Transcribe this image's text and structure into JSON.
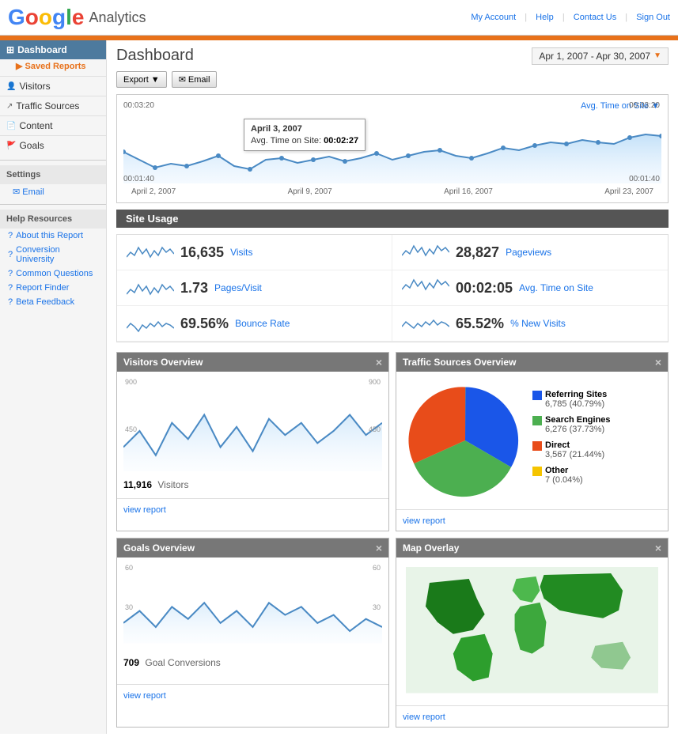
{
  "header": {
    "logo_google": "Google",
    "logo_analytics": "Analytics",
    "nav": {
      "my_account": "My Account",
      "help": "Help",
      "contact_us": "Contact Us",
      "sign_out": "Sign Out"
    }
  },
  "sidebar": {
    "dashboard_label": "Dashboard",
    "saved_reports_label": "Saved Reports",
    "nav_items": [
      {
        "label": "Visitors",
        "icon": "👤"
      },
      {
        "label": "Traffic Sources",
        "icon": "🔗"
      },
      {
        "label": "Content",
        "icon": "📄"
      },
      {
        "label": "Goals",
        "icon": "🎯"
      }
    ],
    "settings": {
      "label": "Settings",
      "items": [
        "Email"
      ]
    },
    "help": {
      "label": "Help Resources",
      "items": [
        "About this Report",
        "Conversion University",
        "Common Questions",
        "Report Finder",
        "Beta Feedback"
      ]
    }
  },
  "main": {
    "page_title": "Dashboard",
    "date_range": "Apr 1, 2007 - Apr 30, 2007",
    "toolbar": {
      "export_label": "Export",
      "email_label": "Email"
    },
    "chart": {
      "label": "Avg. Time on Site ▼",
      "y_top": "00:03:20",
      "y_bottom": "00:01:40",
      "y_top_right": "00:03:20",
      "y_bottom_right": "00:01:40",
      "x_labels": [
        "April 2, 2007",
        "April 9, 2007",
        "April 16, 2007",
        "April 23, 2007"
      ],
      "tooltip": {
        "date": "April 3, 2007",
        "metric_label": "Avg. Time on Site: ",
        "metric_value": "00:02:27"
      }
    },
    "site_usage_label": "Site Usage",
    "metrics": [
      {
        "value": "16,635",
        "label": "Visits"
      },
      {
        "value": "28,827",
        "label": "Pageviews"
      },
      {
        "value": "1.73",
        "label": "Pages/Visit"
      },
      {
        "value": "00:02:05",
        "label": "Avg. Time on Site"
      },
      {
        "value": "69.56%",
        "label": "Bounce Rate"
      },
      {
        "value": "65.52%",
        "label": "% New Visits"
      }
    ],
    "visitors_panel": {
      "title": "Visitors Overview",
      "visitors_count": "11,916",
      "visitors_label": "Visitors",
      "y_top": "900",
      "y_top_right": "900",
      "y_mid": "450",
      "y_mid_right": "450",
      "view_report": "view report"
    },
    "traffic_panel": {
      "title": "Traffic Sources Overview",
      "view_report": "view report",
      "legend": [
        {
          "color": "#1a56e8",
          "name": "Referring Sites",
          "detail": "6,785 (40.79%)"
        },
        {
          "color": "#4caf50",
          "name": "Search Engines",
          "detail": "6,276 (37.73%)"
        },
        {
          "color": "#e84c1a",
          "name": "Direct",
          "detail": "3,567 (21.44%)"
        },
        {
          "color": "#f5c400",
          "name": "Other",
          "detail": "7 (0.04%)"
        }
      ]
    },
    "goals_panel": {
      "title": "Goals Overview",
      "conversions": "709",
      "conversions_label": "Goal Conversions",
      "y_top": "60",
      "y_top_right": "60",
      "y_mid": "30",
      "y_mid_right": "30",
      "view_report": "view report"
    },
    "map_panel": {
      "title": "Map Overlay",
      "view_report": "view report"
    }
  }
}
